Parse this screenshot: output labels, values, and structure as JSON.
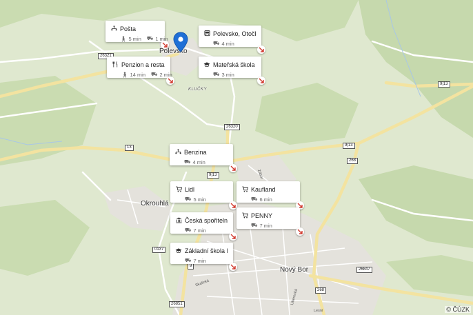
{
  "places": {
    "polevsko": "Polevsko",
    "klucky": "KLUČKY",
    "okrouhla": "Okrouhlá",
    "novy_bor": "Nový Bor"
  },
  "streets": {
    "s1": "Skalická",
    "s2": "Liberecká",
    "s3": "Lesní",
    "s4": "Zábor"
  },
  "roads": {
    "r26321": "26321",
    "r26320": "26320",
    "r913a": "9|13",
    "r913b": "9|13",
    "r913c": "9|13",
    "r13": "13",
    "r268a": "268",
    "r268b": "268",
    "r0137": "0137",
    "r9": "9",
    "r26851": "26851",
    "r26847": "26847"
  },
  "pois": [
    {
      "name": "Pošta",
      "icon": "post-office-icon",
      "walk": "5 min",
      "car": "1 min"
    },
    {
      "name": "Polevsko, Otočka",
      "icon": "bus-stop-icon",
      "car": "4 min"
    },
    {
      "name": "Penzion a restaur…",
      "icon": "restaurant-icon",
      "walk": "14 min",
      "car": "2 min"
    },
    {
      "name": "Mateřská škola P…",
      "icon": "school-icon",
      "car": "3 min"
    },
    {
      "name": "Benzina",
      "icon": "fuel-station-icon",
      "car": "4 min"
    },
    {
      "name": "Lidl",
      "icon": "shopping-cart-icon",
      "car": "5 min"
    },
    {
      "name": "Kaufland",
      "icon": "shopping-cart-icon",
      "car": "6 min"
    },
    {
      "name": "Česká spořitelna",
      "icon": "bank-icon",
      "car": "7 min"
    },
    {
      "name": "PENNY",
      "icon": "shopping-cart-icon",
      "car": "7 min"
    },
    {
      "name": "Základní škola N…",
      "icon": "school-icon",
      "car": "7 min"
    }
  ],
  "copyright": "© ČÚZK",
  "colors": {
    "meadow": "#dfe8cf",
    "forest": "#c9dcb0",
    "road_major": "#f5e6a6",
    "road_minor": "#ffffff",
    "urban": "#e6e4e0",
    "pin": "#1f6fd6",
    "nav_arrow": "#d0362b"
  }
}
